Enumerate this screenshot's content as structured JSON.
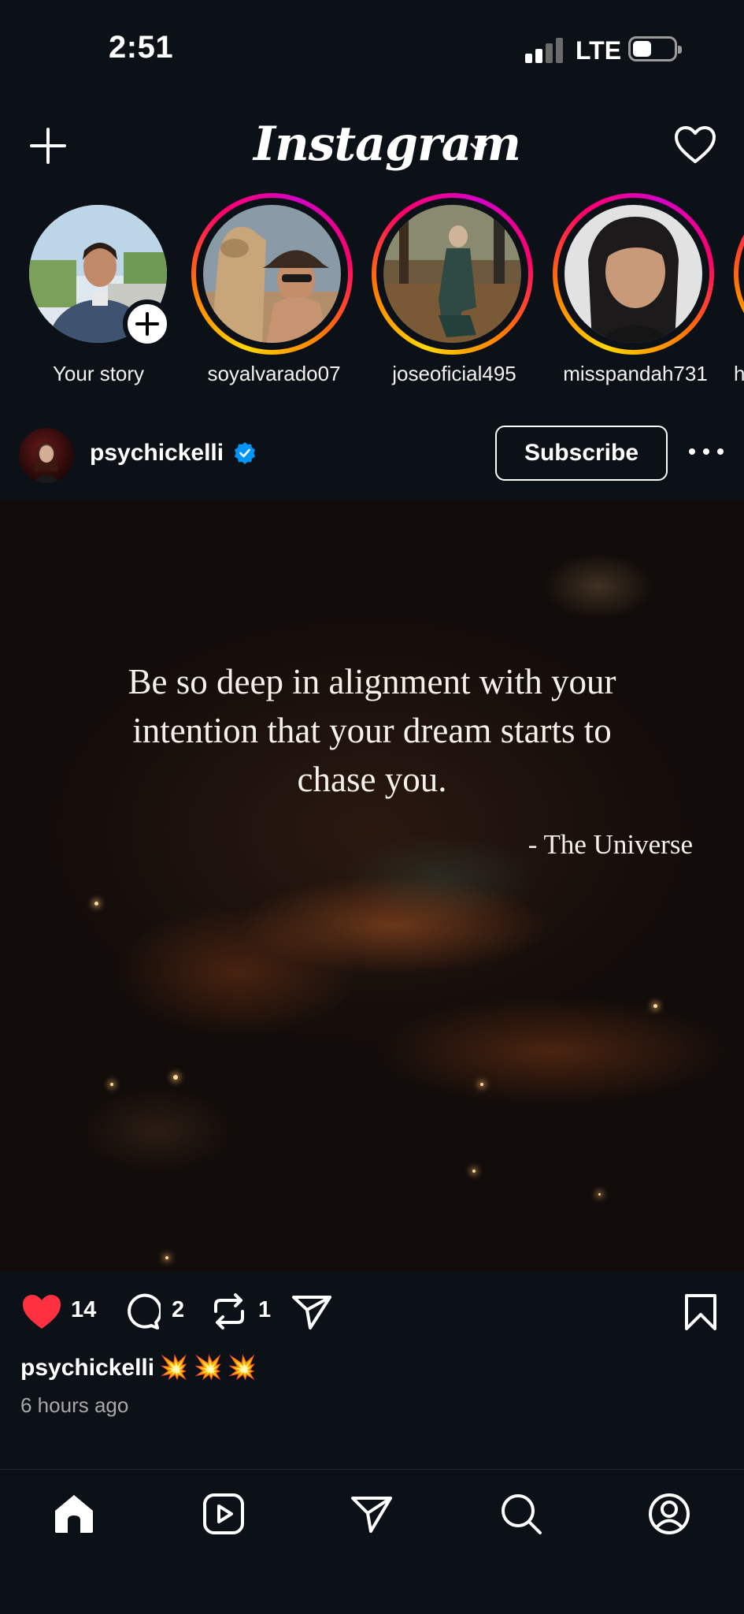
{
  "status_bar": {
    "time": "2:51",
    "network": "LTE"
  },
  "header": {
    "logo": "Instagram",
    "icons": [
      "plus-icon",
      "chevron-down-icon",
      "heart-icon"
    ]
  },
  "stories": [
    {
      "label": "Your story",
      "own": true
    },
    {
      "label": "soyalvarado07",
      "own": false
    },
    {
      "label": "joseoficial495",
      "own": false
    },
    {
      "label": "misspandah731",
      "own": false
    },
    {
      "label": "h",
      "own": false
    }
  ],
  "post": {
    "username": "psychickelli",
    "verified": true,
    "subscribe_label": "Subscribe",
    "quote": "Be so deep in alignment with your intention that your dream starts to chase you.",
    "attribution": "- The Universe",
    "likes": "14",
    "comments": "2",
    "reposts": "1",
    "caption_user": "psychickelli",
    "caption_emoji": "💥💥💥",
    "timestamp": "6 hours ago"
  },
  "colors": {
    "background": "#0c1017",
    "like_red": "#ff3040",
    "verified_blue": "#0095f6"
  },
  "bottom_nav": [
    "home-icon",
    "reels-icon",
    "direct-icon",
    "search-icon",
    "profile-icon"
  ]
}
